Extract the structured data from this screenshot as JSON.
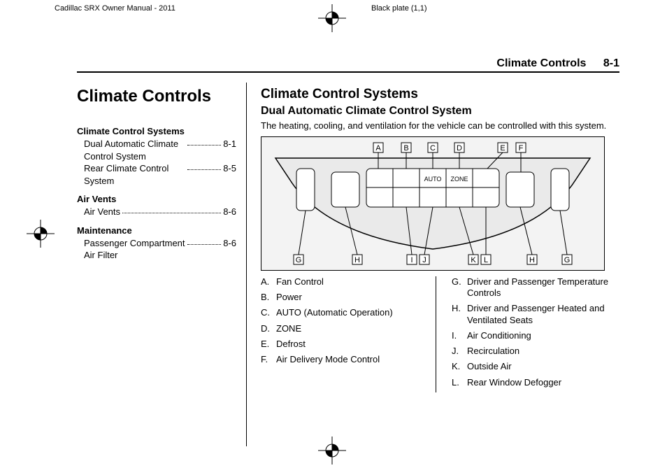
{
  "header": {
    "left": "Cadillac SRX Owner Manual - 2011",
    "right": "Black plate (1,1)"
  },
  "section": {
    "title": "Climate Controls",
    "page": "8-1"
  },
  "chapter_title": "Climate Controls",
  "toc": [
    {
      "head": "Climate Control Systems",
      "items": [
        {
          "label": "Dual Automatic Climate Control System",
          "page": "8-1"
        },
        {
          "label": "Rear Climate Control System",
          "page": "8-5"
        }
      ]
    },
    {
      "head": "Air Vents",
      "items": [
        {
          "label": "Air Vents",
          "page": "8-6"
        }
      ]
    },
    {
      "head": "Maintenance",
      "items": [
        {
          "label": "Passenger Compartment Air Filter",
          "page": "8-6"
        }
      ]
    }
  ],
  "content": {
    "h2": "Climate Control Systems",
    "h3": "Dual Automatic Climate Control System",
    "para": "The heating, cooling, and ventilation for the vehicle can be controlled with this system.",
    "figure_labels": [
      "A",
      "B",
      "C",
      "D",
      "E",
      "F",
      "G",
      "H",
      "I",
      "J",
      "K",
      "L",
      "H",
      "G"
    ],
    "panel_button_labels": [
      "AUTO",
      "ZONE"
    ],
    "legend_left": [
      {
        "k": "A.",
        "v": "Fan Control"
      },
      {
        "k": "B.",
        "v": "Power"
      },
      {
        "k": "C.",
        "v": "AUTO (Automatic Operation)"
      },
      {
        "k": "D.",
        "v": "ZONE"
      },
      {
        "k": "E.",
        "v": "Defrost"
      },
      {
        "k": "F.",
        "v": "Air Delivery Mode Control"
      }
    ],
    "legend_right": [
      {
        "k": "G.",
        "v": "Driver and Passenger Temperature Controls"
      },
      {
        "k": "H.",
        "v": "Driver and Passenger Heated and Ventilated Seats"
      },
      {
        "k": "I.",
        "v": "Air Conditioning"
      },
      {
        "k": "J.",
        "v": "Recirculation"
      },
      {
        "k": "K.",
        "v": "Outside Air"
      },
      {
        "k": "L.",
        "v": "Rear Window Defogger"
      }
    ]
  }
}
